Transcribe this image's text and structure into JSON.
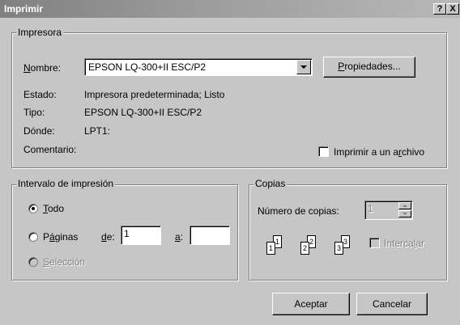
{
  "window": {
    "title": "Imprimir",
    "help_glyph": "?",
    "close_glyph": "X"
  },
  "printer": {
    "group_label": "Impresora",
    "name_label": "Nombre:",
    "name_value": "EPSON LQ-300+II ESC/P2",
    "properties_button": "Propiedades...",
    "status_label": "Estado:",
    "status_value": "Impresora predeterminada; Listo",
    "type_label": "Tipo:",
    "type_value": "EPSON LQ-300+II ESC/P2",
    "where_label": "Dónde:",
    "where_value": "LPT1:",
    "comment_label": "Comentario:",
    "print_to_file_label": "Imprimir a un archivo",
    "print_to_file_checked": false
  },
  "range": {
    "group_label": "Intervalo de impresión",
    "all_label": "Todo",
    "all_selected": true,
    "pages_label": "Páginas",
    "from_label": "de:",
    "from_value": "1",
    "to_label": "a:",
    "to_value": "",
    "selection_label": "Selección"
  },
  "copies": {
    "group_label": "Copias",
    "count_label": "Número de copias:",
    "count_value": "1",
    "collate_label": "Intercalar",
    "collate_checked": false,
    "collate_pages": [
      "1",
      "1",
      "2",
      "2",
      "3",
      "3"
    ]
  },
  "footer": {
    "ok_button": "Aceptar",
    "cancel_button": "Cancelar"
  }
}
